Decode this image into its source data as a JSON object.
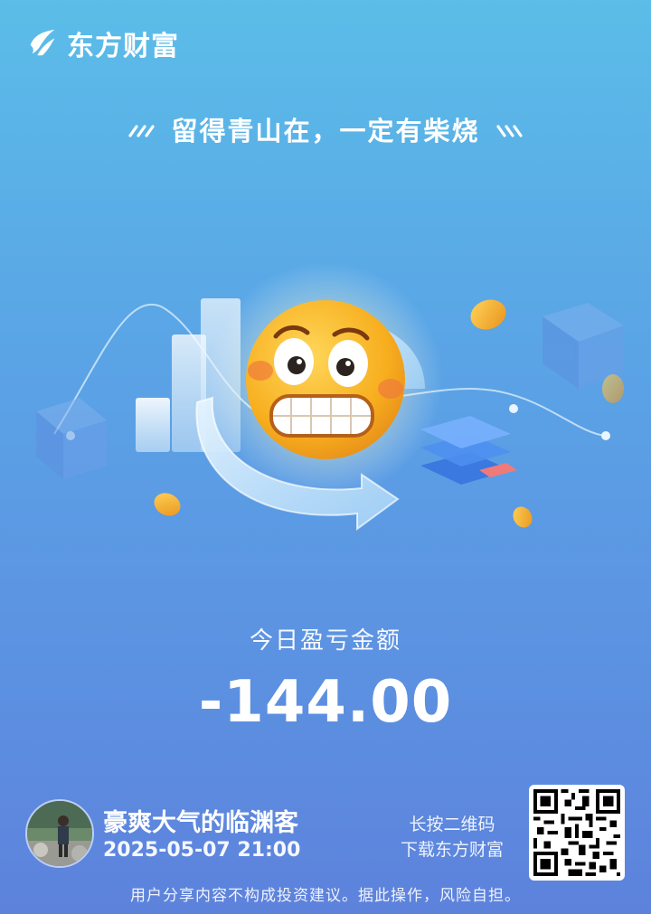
{
  "header": {
    "logo_text": "东方财富",
    "logo_icon": "eastmoney-flame-icon"
  },
  "slogan": {
    "text": "留得青山在，一定有柴烧"
  },
  "illustration": {
    "name": "nervous-emoji-with-cycle-arrow"
  },
  "pnl": {
    "label": "今日盈亏金额",
    "amount": "-144.00"
  },
  "user": {
    "name": "豪爽大气的临渊客",
    "datetime": "2025-05-07 21:00"
  },
  "qr": {
    "hint_line1": "长按二维码",
    "hint_line2": "下载东方财富"
  },
  "footer": {
    "disclaimer": "用户分享内容不构成投资建议。据此操作，风险自担。"
  },
  "colors": {
    "bg_top": "#5bbde8",
    "bg_bottom": "#5d82dc",
    "emoji": "#f6b21f"
  }
}
